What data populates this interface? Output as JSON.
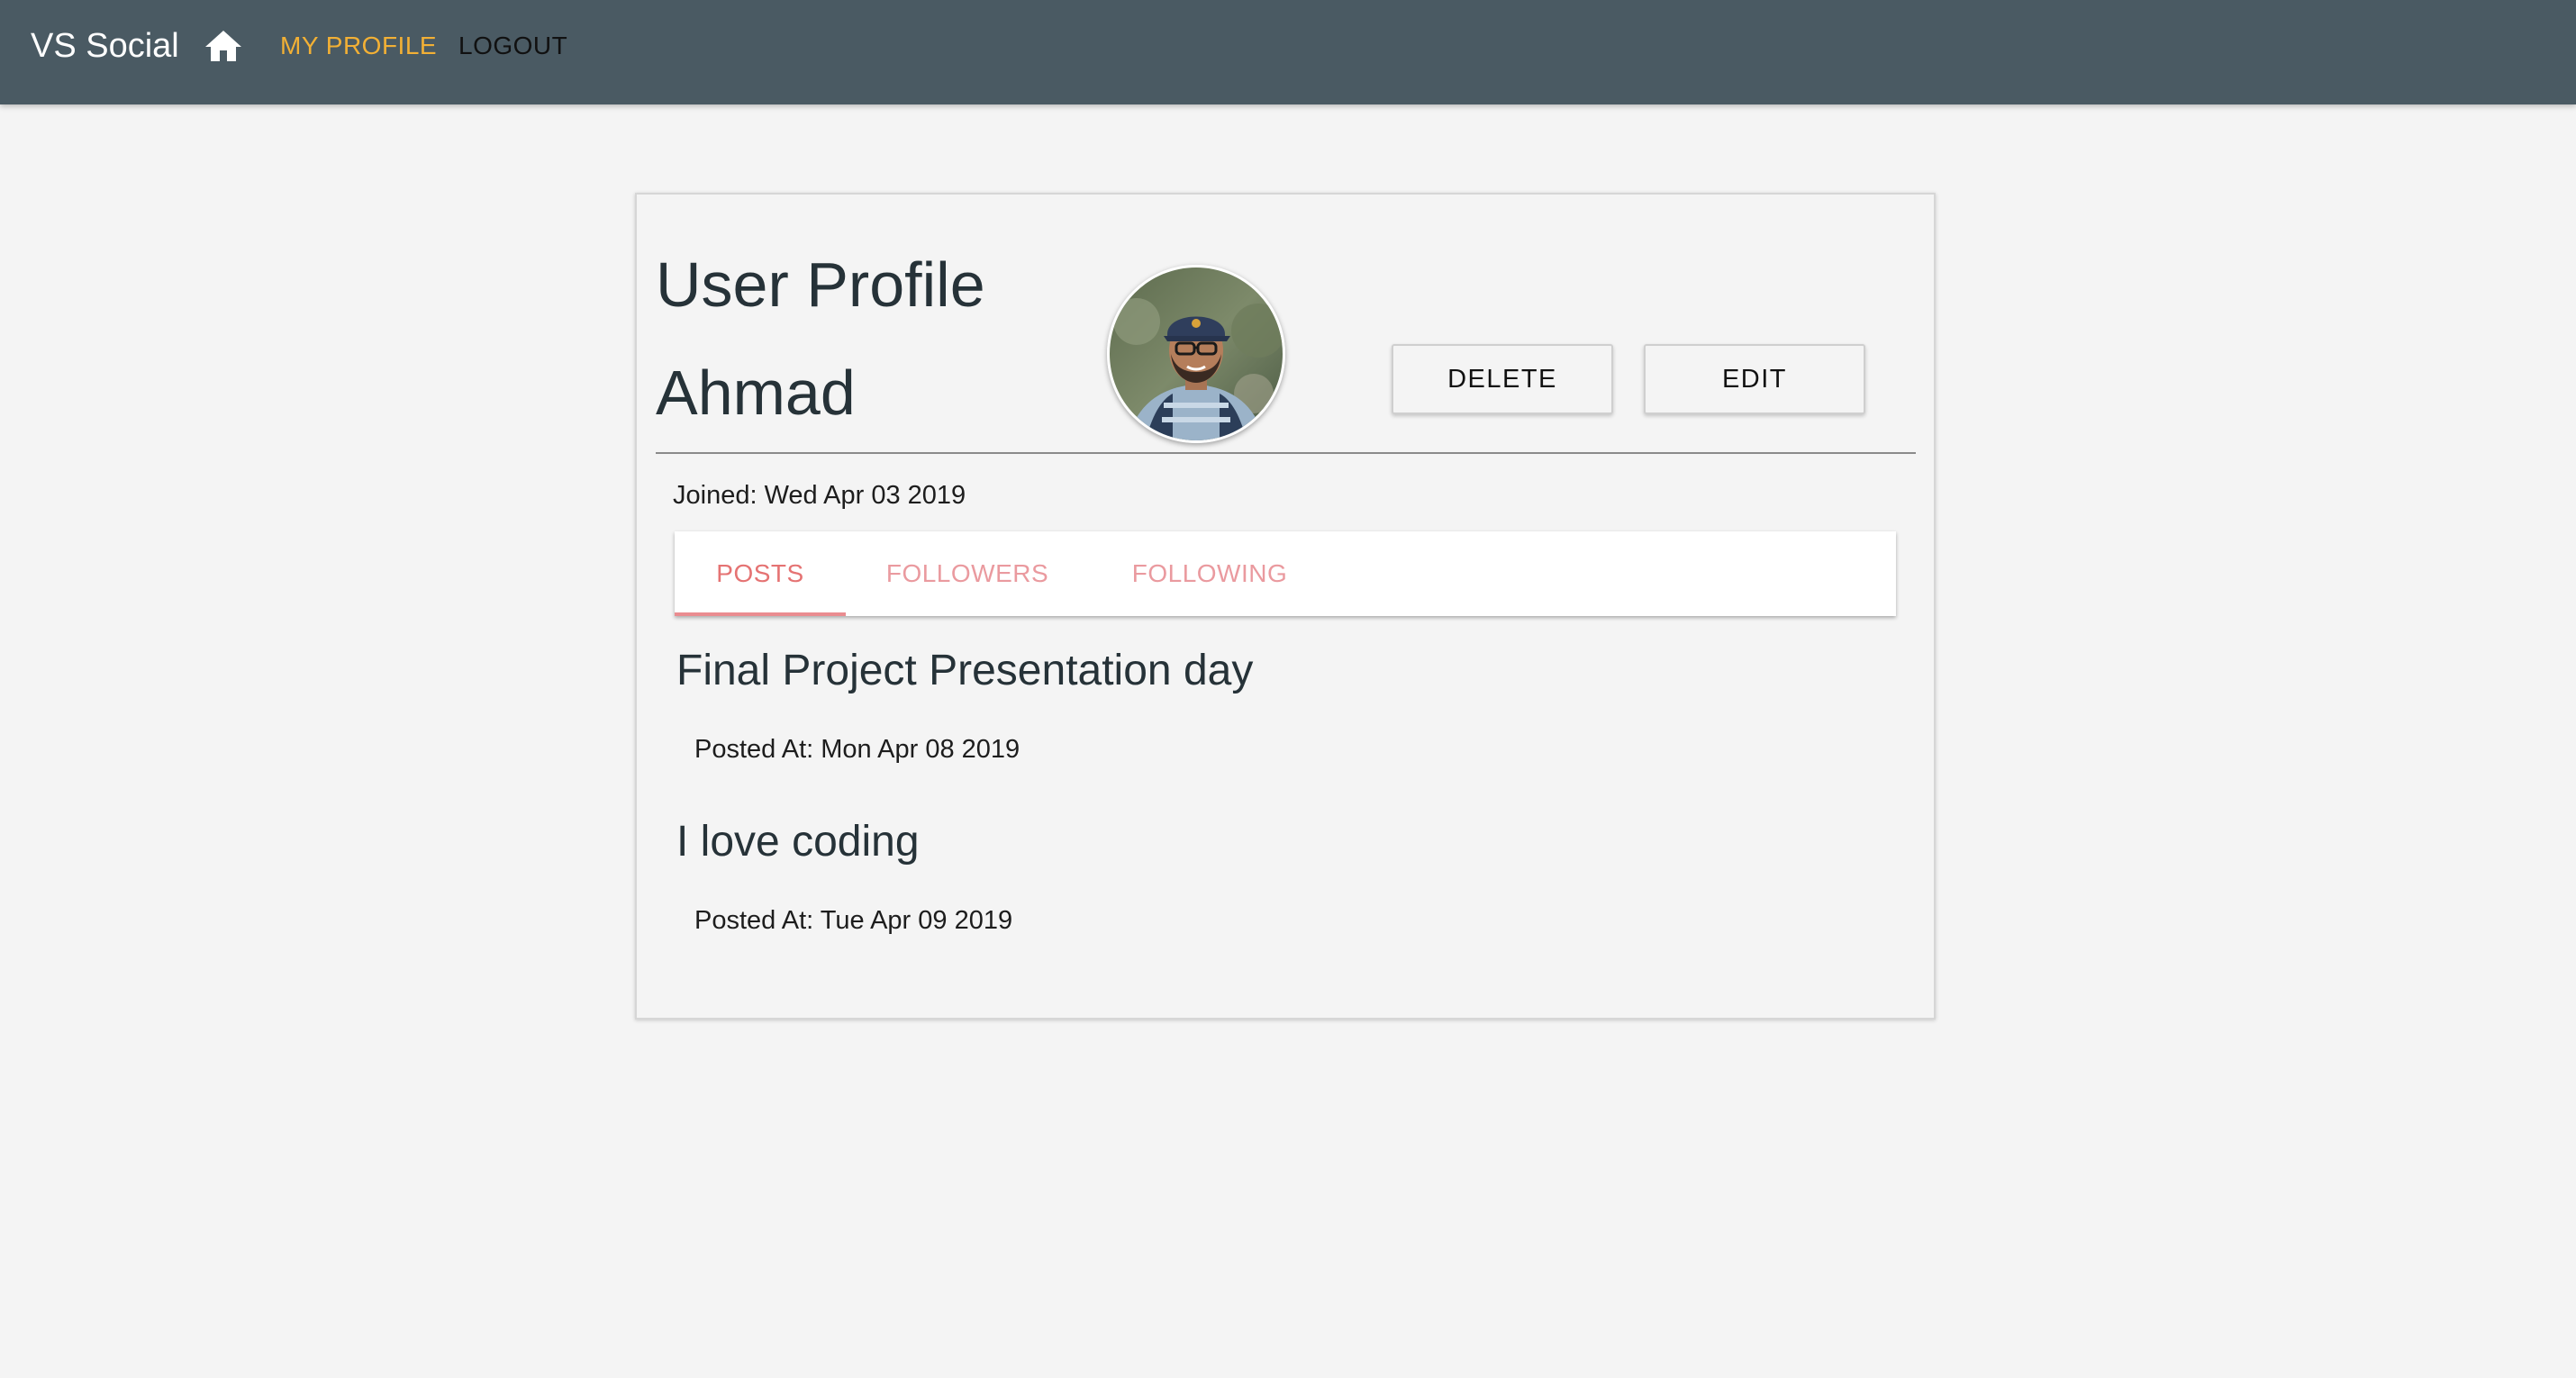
{
  "appbar": {
    "brand": "VS Social",
    "home_icon": "home-icon",
    "nav": {
      "my_profile": "MY PROFILE",
      "logout": "LOGOUT"
    }
  },
  "profile": {
    "title": "User Profile",
    "name": "Ahmad",
    "avatar": "avatar-photo",
    "buttons": {
      "delete": "DELETE",
      "edit": "EDIT"
    },
    "joined": "Joined: Wed Apr 03 2019"
  },
  "tabs": [
    {
      "label": "POSTS",
      "active": true
    },
    {
      "label": "FOLLOWERS",
      "active": false
    },
    {
      "label": "FOLLOWING",
      "active": false
    }
  ],
  "posts": [
    {
      "title": "Final Project Presentation day",
      "posted": "Posted At: Mon Apr 08 2019"
    },
    {
      "title": "I love coding",
      "posted": "Posted At: Tue Apr 09 2019"
    }
  ],
  "colors": {
    "appbar": "#4a5a63",
    "nav_active": "#f2b035",
    "tab_active": "#e57373",
    "tab_inactive": "#ea9a9f",
    "page_bg": "#f4f4f4"
  }
}
